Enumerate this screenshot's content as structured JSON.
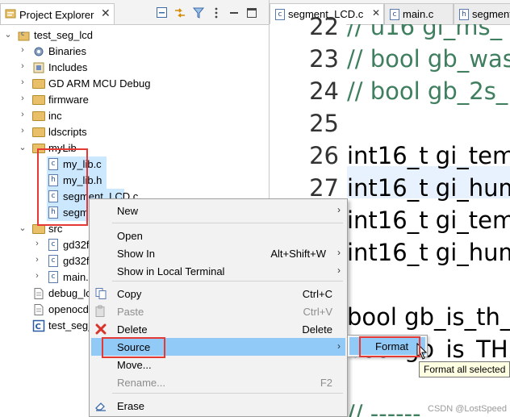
{
  "explorer": {
    "tab_label": "Project Explorer",
    "tab_close": "✕",
    "tree": [
      {
        "label": "test_seg_lcd",
        "chev": "⌄",
        "icon": "project-icon",
        "indent": 0
      },
      {
        "label": "Binaries",
        "chev": "›",
        "icon": "binaries-icon",
        "indent": 1
      },
      {
        "label": "Includes",
        "chev": "›",
        "icon": "includes-icon",
        "indent": 1
      },
      {
        "label": "GD ARM MCU Debug",
        "chev": "›",
        "icon": "folder-icon",
        "indent": 1
      },
      {
        "label": "firmware",
        "chev": "›",
        "icon": "folder-icon",
        "indent": 1
      },
      {
        "label": "inc",
        "chev": "›",
        "icon": "folder-icon",
        "indent": 1
      },
      {
        "label": "ldscripts",
        "chev": "›",
        "icon": "folder-icon",
        "indent": 1
      },
      {
        "label": "myLib",
        "chev": "⌄",
        "icon": "folder-icon",
        "indent": 1
      },
      {
        "label": "my_lib.c",
        "chev": "",
        "icon": "c-file-icon",
        "indent": 2
      },
      {
        "label": "my_lib.h",
        "chev": "",
        "icon": "h-file-icon",
        "indent": 2
      },
      {
        "label": "segment_LCD.c",
        "chev": "",
        "icon": "c-file-icon",
        "indent": 2
      },
      {
        "label": "segm",
        "chev": "",
        "icon": "h-file-icon",
        "indent": 2
      },
      {
        "label": "src",
        "chev": "⌄",
        "icon": "folder-icon",
        "indent": 1
      },
      {
        "label": "gd32f",
        "chev": "›",
        "icon": "c-file-icon",
        "indent": 2
      },
      {
        "label": "gd32f",
        "chev": "›",
        "icon": "c-file-icon",
        "indent": 2
      },
      {
        "label": "main.c",
        "chev": "›",
        "icon": "c-file-icon",
        "indent": 2
      },
      {
        "label": "debug_lc",
        "chev": "",
        "icon": "doc-icon",
        "indent": 1
      },
      {
        "label": "openocd",
        "chev": "",
        "icon": "doc-icon",
        "indent": 1
      },
      {
        "label": "test_seg_",
        "chev": "",
        "icon": "launch-icon",
        "indent": 1
      }
    ]
  },
  "editor": {
    "tabs": [
      {
        "label": "segment_LCD.c",
        "close": "✕",
        "icon": "c-file-icon"
      },
      {
        "label": "main.c",
        "close": "",
        "icon": "c-file-icon"
      },
      {
        "label": "segment",
        "close": "",
        "icon": "h-file-icon"
      }
    ],
    "lines": [
      {
        "no": "22",
        "text": "// u16 gi_ms_",
        "comment": true
      },
      {
        "no": "23",
        "text": "// bool gb_was",
        "comment": true
      },
      {
        "no": "24",
        "text": "// bool gb_2s_",
        "comment": true
      },
      {
        "no": "25",
        "text": "",
        "comment": false
      },
      {
        "no": "26",
        "text": "int16_t gi_temp",
        "comment": false
      },
      {
        "no": "27",
        "text": "int16_t gi_hum",
        "comment": false
      },
      {
        "no": "",
        "text": "int16_t gi_temp",
        "comment": false
      },
      {
        "no": "",
        "text": "int16_t gi_hum",
        "comment": false
      },
      {
        "no": "",
        "text": "",
        "comment": false
      },
      {
        "no": "",
        "text": "bool gb_is_th_",
        "comment": false
      },
      {
        "no": "",
        "text": "bool gb_is_TH_",
        "comment": false
      },
      {
        "no": "",
        "text": "",
        "comment": false
      },
      {
        "no": "",
        "text": "// ------",
        "comment": true
      }
    ]
  },
  "context_menu": {
    "items": [
      {
        "label": "New",
        "key": "",
        "arrow": "›",
        "state": "normal",
        "icon": ""
      },
      {
        "label": "Open",
        "key": "",
        "arrow": "",
        "state": "normal",
        "icon": ""
      },
      {
        "label": "Show In",
        "key": "Alt+Shift+W",
        "arrow": "›",
        "state": "normal",
        "icon": ""
      },
      {
        "label": "Show in Local Terminal",
        "key": "",
        "arrow": "›",
        "state": "normal",
        "icon": ""
      },
      {
        "label": "Copy",
        "key": "Ctrl+C",
        "arrow": "",
        "state": "normal",
        "icon": "copy-icon"
      },
      {
        "label": "Paste",
        "key": "Ctrl+V",
        "arrow": "",
        "state": "disabled",
        "icon": "paste-icon"
      },
      {
        "label": "Delete",
        "key": "Delete",
        "arrow": "",
        "state": "normal",
        "icon": "delete-icon"
      },
      {
        "label": "Source",
        "key": "",
        "arrow": "›",
        "state": "active",
        "icon": ""
      },
      {
        "label": "Move...",
        "key": "",
        "arrow": "",
        "state": "normal",
        "icon": ""
      },
      {
        "label": "Rename...",
        "key": "F2",
        "arrow": "",
        "state": "disabled",
        "icon": ""
      },
      {
        "label": "Erase",
        "key": "",
        "arrow": "",
        "state": "normal",
        "icon": "erase-icon"
      }
    ]
  },
  "submenu": {
    "label": "Format"
  },
  "tooltip": {
    "text": "Format all selected"
  },
  "watermark": "CSDN @LostSpeed",
  "colors": {
    "selection": "#cce8ff",
    "menu_active": "#91c9f7",
    "highlight_box": "#e53935",
    "comment": "#3f7f5f"
  }
}
